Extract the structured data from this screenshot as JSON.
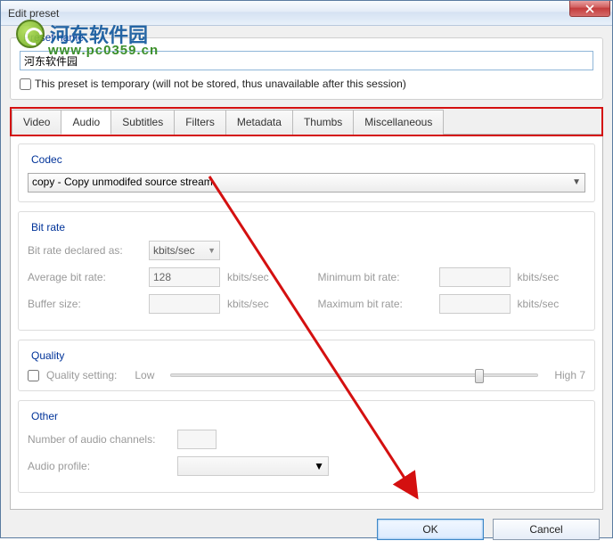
{
  "window": {
    "title": "Edit preset"
  },
  "watermark": {
    "cn": "河东软件园",
    "url": "www.pc0359.cn"
  },
  "preset": {
    "legend": "Preset name",
    "value": "河东软件园",
    "temp_label": "This preset is temporary (will not be stored, thus unavailable after this session)"
  },
  "tabs": [
    "Video",
    "Audio",
    "Subtitles",
    "Filters",
    "Metadata",
    "Thumbs",
    "Miscellaneous"
  ],
  "active_tab": "Audio",
  "codec": {
    "legend": "Codec",
    "value": "copy - Copy unmodifed source stream"
  },
  "bitrate": {
    "legend": "Bit rate",
    "declared_lbl": "Bit rate declared as:",
    "declared_val": "kbits/sec",
    "avg_lbl": "Average bit rate:",
    "avg_val": "128",
    "unit": "kbits/sec",
    "buf_lbl": "Buffer size:",
    "min_lbl": "Minimum bit rate:",
    "max_lbl": "Maximum bit rate:"
  },
  "quality": {
    "legend": "Quality",
    "setting_lbl": "Quality setting:",
    "low": "Low",
    "high": "High  7"
  },
  "other": {
    "legend": "Other",
    "channels_lbl": "Number of audio channels:",
    "profile_lbl": "Audio profile:"
  },
  "buttons": {
    "ok": "OK",
    "cancel": "Cancel"
  }
}
